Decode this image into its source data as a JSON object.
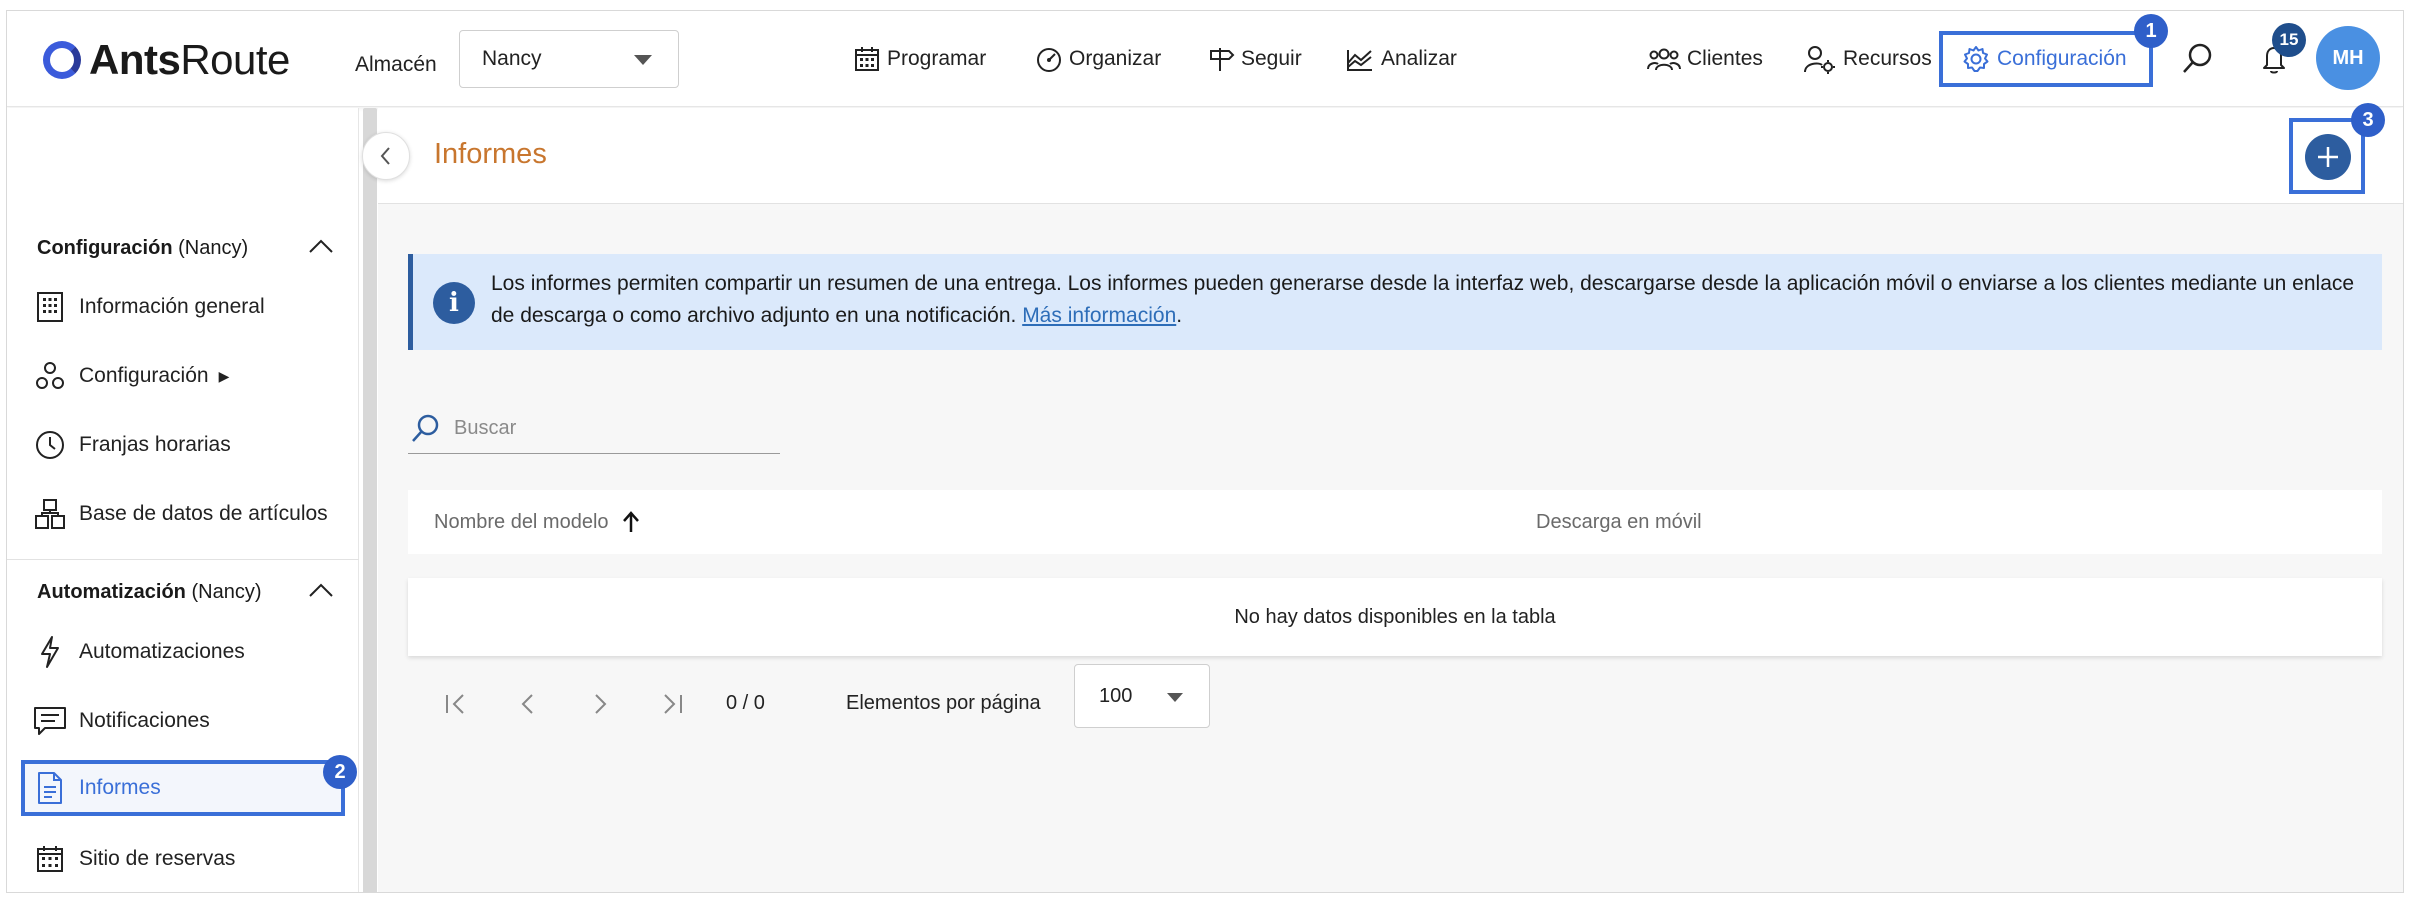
{
  "brand": {
    "bold": "Ants",
    "regular": "Route"
  },
  "warehouse": {
    "label": "Almacén",
    "value": "Nancy"
  },
  "nav": {
    "programar": "Programar",
    "organizar": "Organizar",
    "seguir": "Seguir",
    "analizar": "Analizar",
    "clientes": "Clientes",
    "recursos": "Recursos",
    "configuracion": "Configuración"
  },
  "notifications": {
    "count": "15"
  },
  "user": {
    "initials": "MH"
  },
  "steps": {
    "one": "1",
    "two": "2",
    "three": "3"
  },
  "sidebar": {
    "section1": {
      "title": "Configuración",
      "scope": "(Nancy)"
    },
    "section1_items": {
      "general": "Información general",
      "config": "Configuración",
      "config_arrow": "▶",
      "slots": "Franjas horarias",
      "articles": "Base de datos de artículos"
    },
    "section2": {
      "title": "Automatización",
      "scope": "(Nancy)"
    },
    "section2_items": {
      "automations": "Automatizaciones",
      "notifications": "Notificaciones",
      "reports": "Informes",
      "booking": "Sitio de reservas"
    }
  },
  "main": {
    "title": "Informes",
    "info": {
      "text": "Los informes permiten compartir un resumen de una entrega. Los informes pueden generarse desde la interfaz web, descargarse desde la aplicación móvil o enviarse a los clientes mediante un enlace de descarga o como archivo adjunto en una notificación. ",
      "link": "Más información",
      "end": "."
    },
    "search": {
      "placeholder": "Buscar"
    },
    "table": {
      "col1": "Nombre del modelo",
      "col2": "Descarga en móvil",
      "empty": "No hay datos disponibles en la tabla"
    },
    "pager": {
      "count": "0 / 0",
      "per_page_label": "Elementos por página",
      "per_page_value": "100"
    }
  },
  "colors": {
    "accent": "#3a6fd8",
    "primary_dark": "#2d5d9f",
    "title_orange": "#c8762e",
    "info_bg": "#dbe9fb"
  }
}
